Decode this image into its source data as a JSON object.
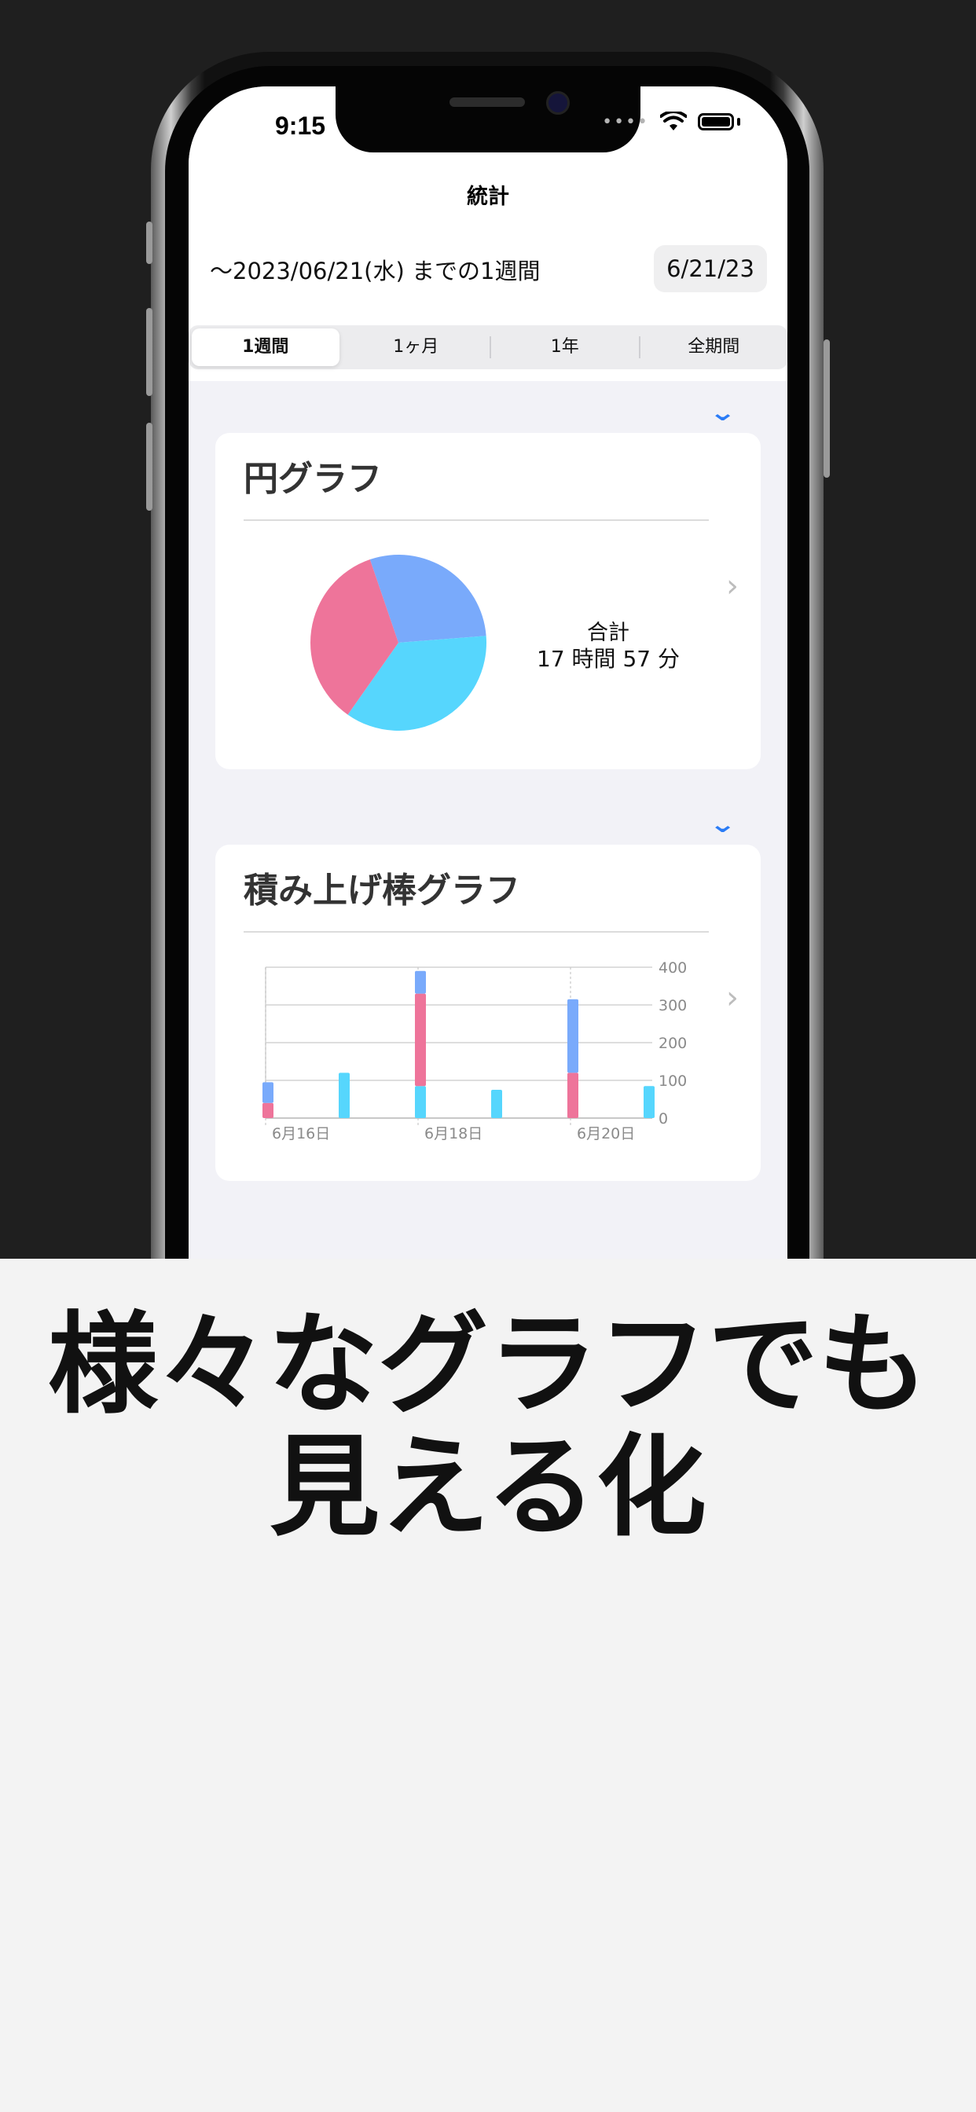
{
  "status_bar": {
    "time": "9:15",
    "signal": "••••"
  },
  "nav": {
    "title": "統計"
  },
  "range": {
    "text": "〜2023/06/21(水) までの1週間",
    "date_button": "6/21/23"
  },
  "segments": [
    {
      "label": "1週間",
      "active": true
    },
    {
      "label": "1ヶ月",
      "active": false
    },
    {
      "label": "1年",
      "active": false
    },
    {
      "label": "全期間",
      "active": false
    }
  ],
  "toggle_icon": "chevron-down-icon",
  "pie_card": {
    "title": "円グラフ",
    "total_label": "合計",
    "total_value": "17 時間 57 分"
  },
  "bar_card": {
    "title": "積み上げ棒グラフ"
  },
  "colors": {
    "cyan": "#56d6fd",
    "pink": "#ee749a",
    "blue": "#79aafb",
    "accent": "#2b7cf6"
  },
  "chart_data": [
    {
      "type": "pie",
      "slices": [
        {
          "color": "#79aafb",
          "value": 29
        },
        {
          "color": "#56d6fd",
          "value": 36
        },
        {
          "color": "#ee749a",
          "value": 35
        }
      ]
    },
    {
      "type": "bar",
      "stacked": true,
      "categories": [
        "6月16日",
        "6月17日",
        "6月18日",
        "6月19日",
        "6月20日",
        "6月21日"
      ],
      "tick_labels": [
        "6月16日",
        "6月18日",
        "6月20日"
      ],
      "y_ticks": [
        "0",
        "100",
        "200",
        "300",
        "400"
      ],
      "ylim": [
        0,
        400
      ],
      "series": [
        {
          "color": "#56d6fd",
          "values": [
            0,
            120,
            85,
            75,
            0,
            85
          ]
        },
        {
          "color": "#ee749a",
          "values": [
            40,
            0,
            245,
            0,
            120,
            0
          ]
        },
        {
          "color": "#79aafb",
          "values": [
            55,
            0,
            60,
            0,
            195,
            0
          ]
        }
      ],
      "grid": true
    }
  ],
  "caption": {
    "line1": "様々なグラフでも",
    "line2": "見える化"
  }
}
